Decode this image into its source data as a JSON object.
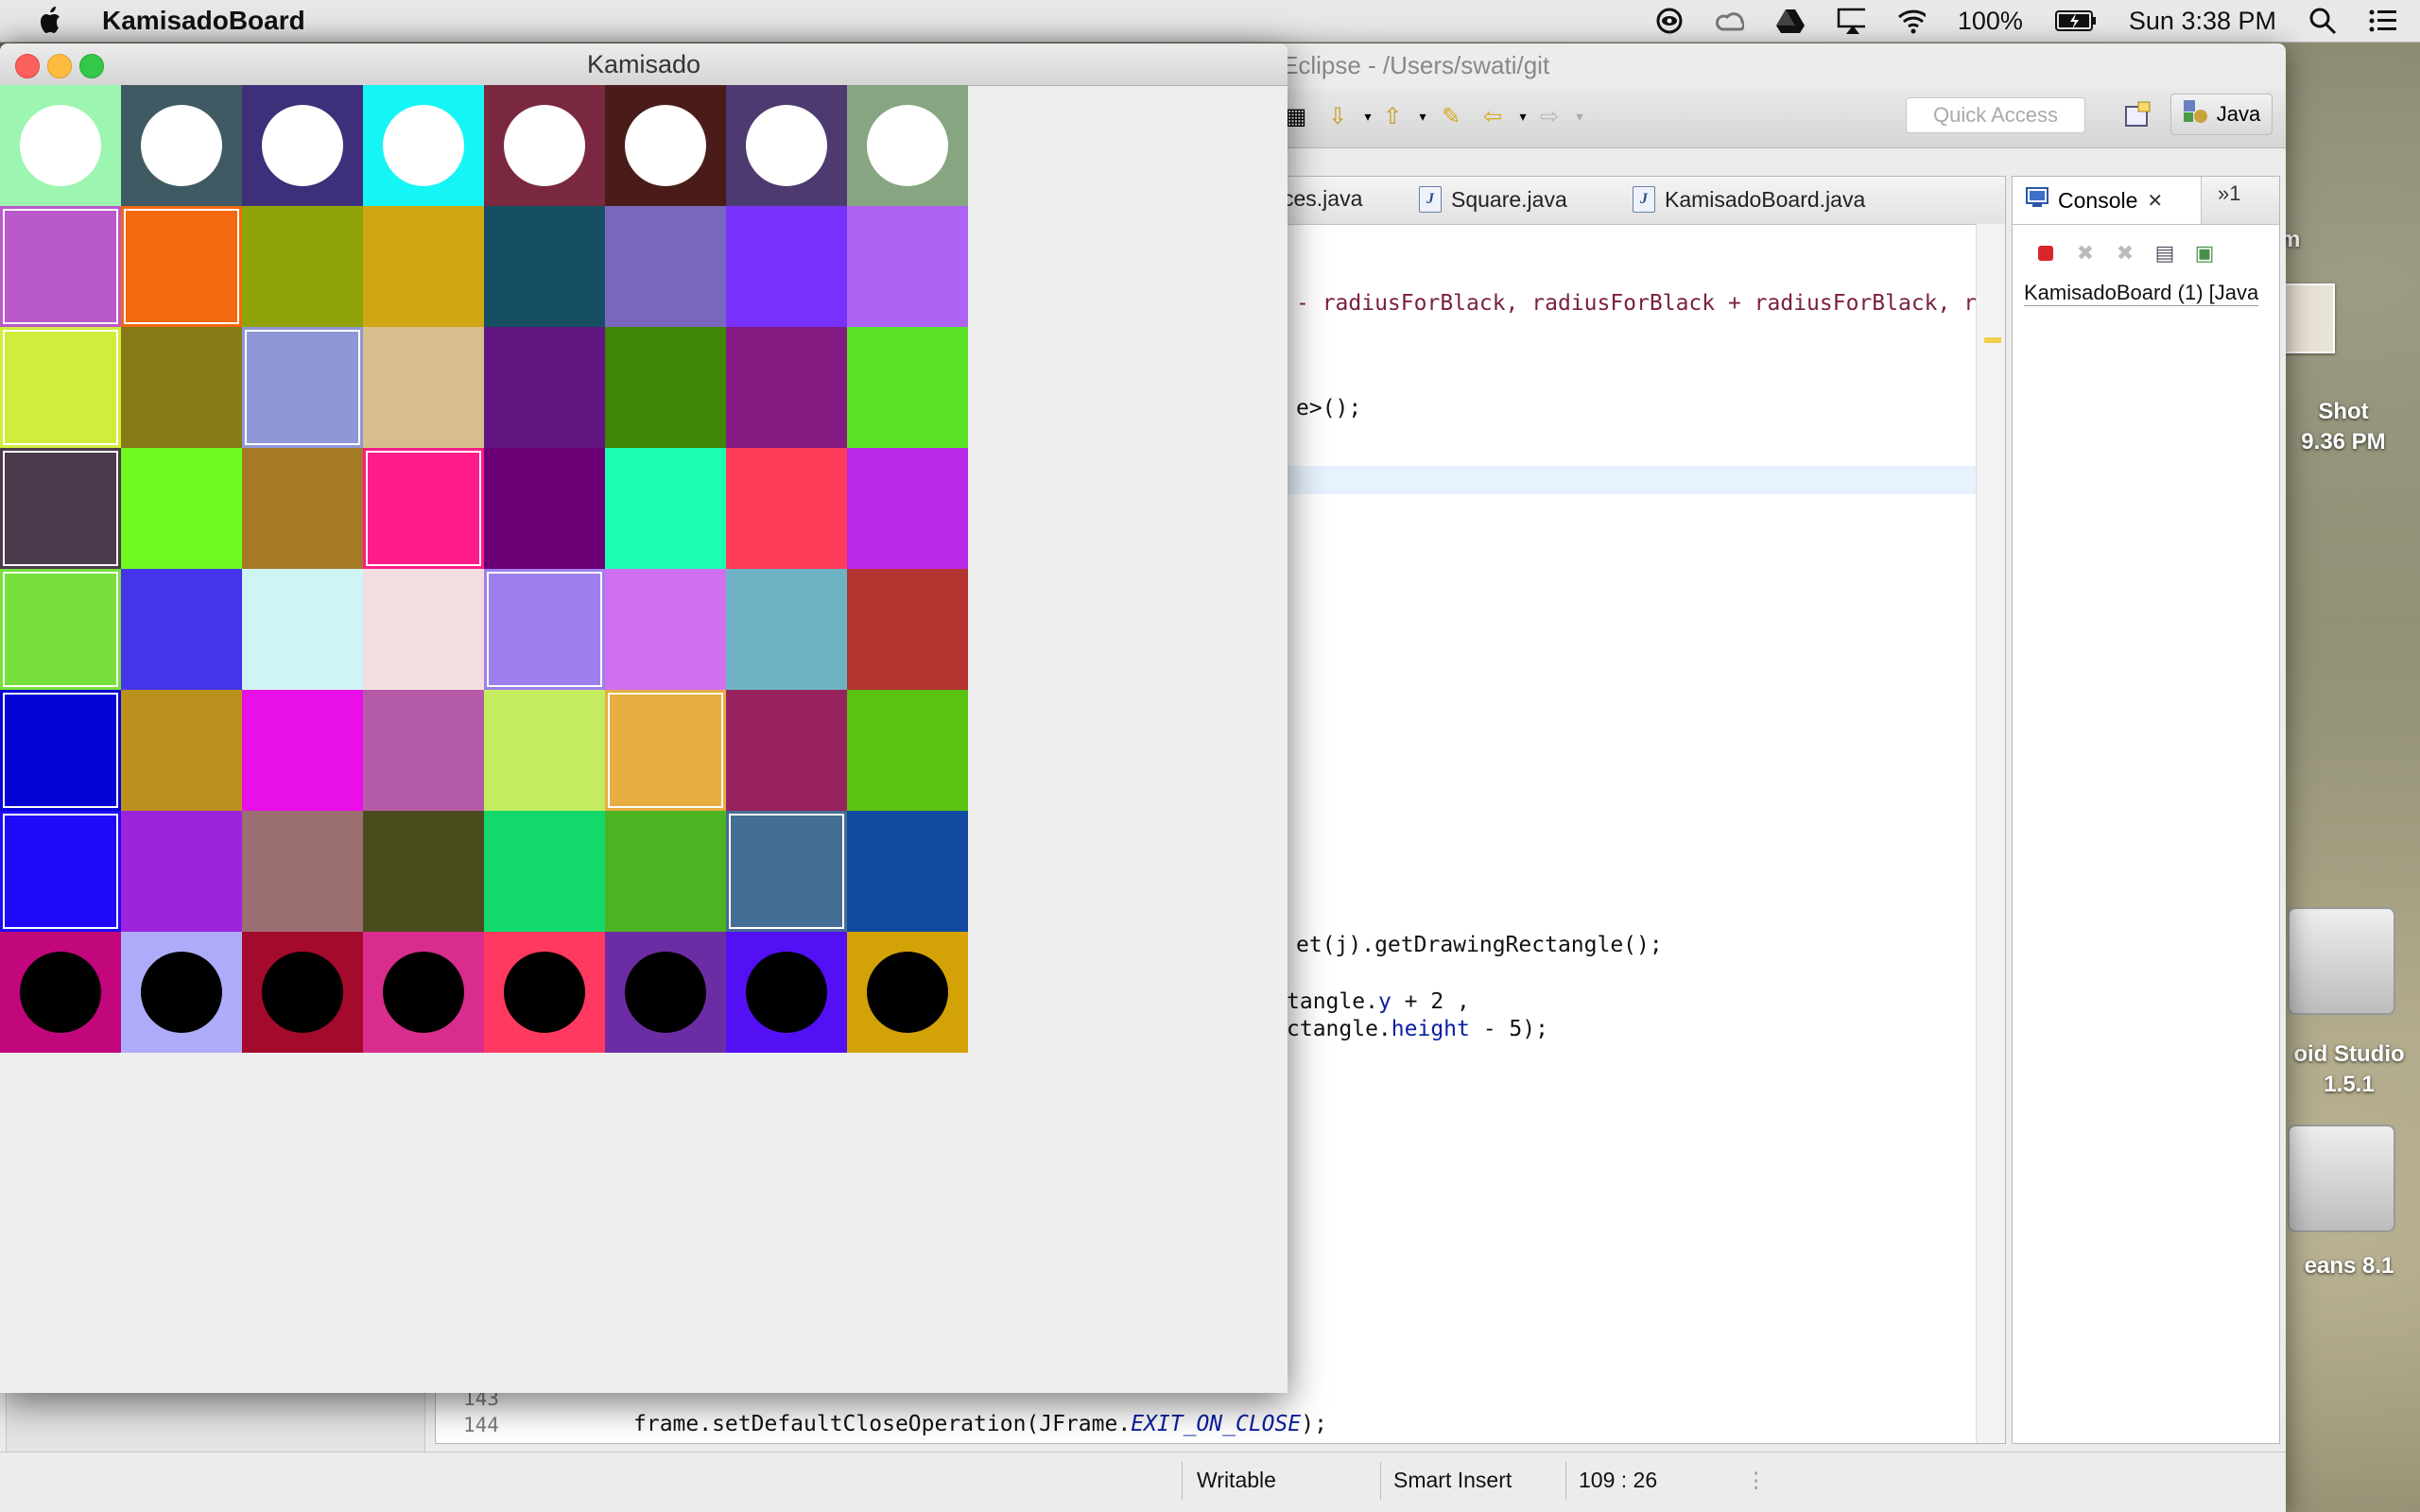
{
  "menubar": {
    "app_name": "KamisadoBoard",
    "battery": "100%",
    "clock": "Sun 3:38 PM"
  },
  "desktop": {
    "icons": [
      {
        "label": "m"
      },
      {
        "label": "Shot\n9.36 PM"
      },
      {
        "label": "oid Studio\n1.5.1"
      },
      {
        "label": "eans 8.1"
      }
    ]
  },
  "eclipse": {
    "title": "Eclipse - /Users/swati/git",
    "quick_access": "Quick Access",
    "perspective": "Java",
    "tabs": [
      "ces.java",
      "Square.java",
      "KamisadoBoard.java"
    ],
    "console_tab": "Console",
    "more_views": "»1",
    "console_text": "KamisadoBoard (1) [Java",
    "code": {
      "line1": "- radiusForBlack, radiusForBlack + radiusForBlack, r",
      "line2": "e>();",
      "line3": "et(j).getDrawingRectangle();",
      "line4a": "tangle.",
      "line4b": "y",
      "line4c": " + 2 ,",
      "line5a": "ctangle.",
      "line5b": "height",
      "line5c": " - 5);",
      "line6a": "frame.setDefaultCloseOperation(JFrame.",
      "line6b": "EXIT_ON_CLOSE",
      "line6c": ");"
    },
    "line_numbers": [
      "143",
      "144"
    ],
    "status": {
      "writable": "Writable",
      "insert_mode": "Smart Insert",
      "position": "109 : 26"
    }
  },
  "kamisado": {
    "title": "Kamisado",
    "rows": [
      {
        "colors": [
          "#9cf5b0",
          "#3f5a62",
          "#3d2f7a",
          "#16f5f5",
          "#7a2840",
          "#491c1a",
          "#4c3a70",
          "#86a580"
        ],
        "outlined": [],
        "piece": "#ffffff"
      },
      {
        "colors": [
          "#b959cb",
          "#f2690f",
          "#90a30a",
          "#cfa613",
          "#174f62",
          "#7a66be",
          "#7732fc",
          "#ad63f3"
        ],
        "outlined": [
          0,
          1
        ],
        "piece": null
      },
      {
        "colors": [
          "#d2ec3c",
          "#887a14",
          "#9097d7",
          "#d8be8d",
          "#611681",
          "#3d8704",
          "#851a83",
          "#59e324"
        ],
        "outlined": [
          0,
          2
        ],
        "piece": null
      },
      {
        "colors": [
          "#4b3b4c",
          "#6ffb22",
          "#a47a27",
          "#ff1b8a",
          "#6c0177",
          "#1cfdb4",
          "#ff3c5a",
          "#bb29e8"
        ],
        "outlined": [
          0,
          3
        ],
        "piece": null
      },
      {
        "colors": [
          "#78e03a",
          "#4534e8",
          "#cff4f5",
          "#f2dede",
          "#9d7fee",
          "#d170ef",
          "#6db3c3",
          "#b43431"
        ],
        "outlined": [
          0,
          4
        ],
        "piece": null
      },
      {
        "colors": [
          "#0404d4",
          "#bb901c",
          "#e90fe9",
          "#b55aa6",
          "#c4ec60",
          "#e7ad41",
          "#98225e",
          "#5ac213"
        ],
        "outlined": [
          0,
          5
        ],
        "piece": null
      },
      {
        "colors": [
          "#1e0af8",
          "#9d24dc",
          "#9b6e72",
          "#4b4c1e",
          "#12d96a",
          "#4cb323",
          "#456e94",
          "#114aa0"
        ],
        "outlined": [
          0,
          6
        ],
        "piece": null
      },
      {
        "colors": [
          "#c2067b",
          "#aeacfa",
          "#a40a2c",
          "#d82d8c",
          "#ff3960",
          "#6c2da4",
          "#5310f5",
          "#d3a207"
        ],
        "outlined": [],
        "piece": "#000000"
      }
    ]
  }
}
